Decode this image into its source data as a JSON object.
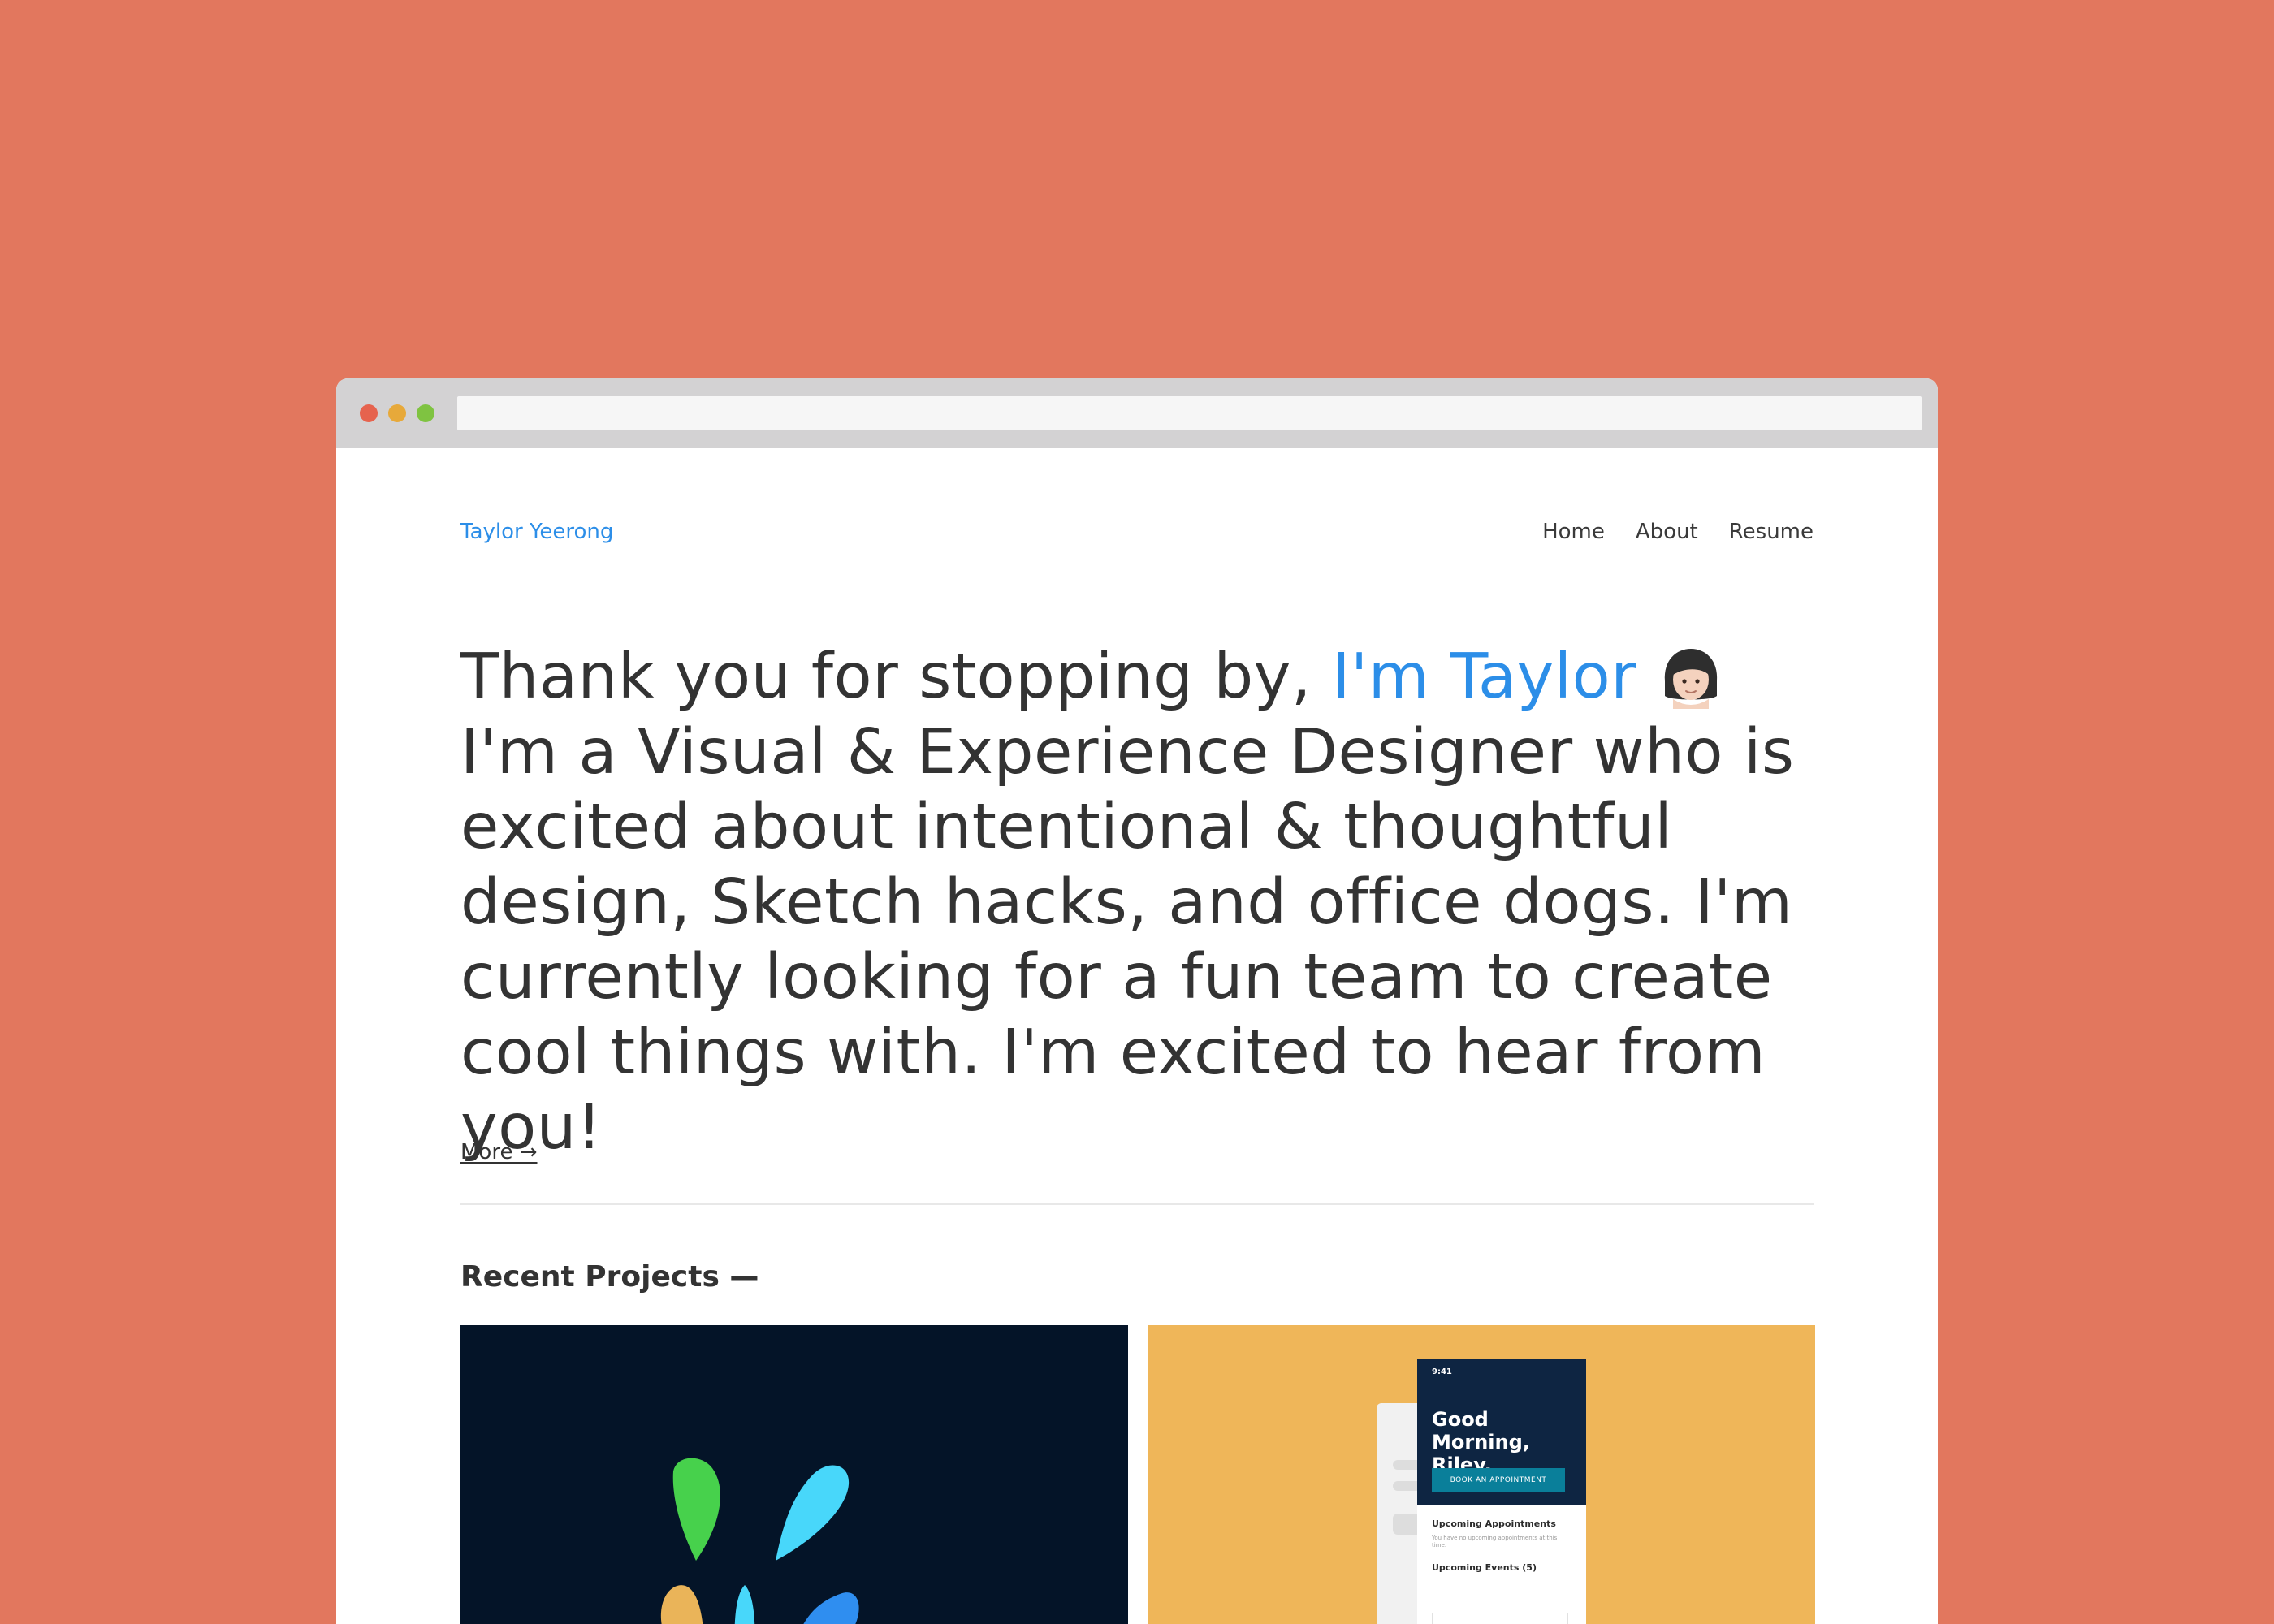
{
  "header": {
    "brand": "Taylor Yeerong",
    "nav": [
      "Home",
      "About",
      "Resume"
    ]
  },
  "intro": {
    "lead": "Thank you for stopping by, ",
    "name": "I'm Taylor",
    "avatar_icon": "woman-emoji-icon",
    "rest": " I'm a Visual & Experience Designer who is excited about intentional & thoughtful design, Sketch hacks, and office dogs. I'm currently looking for a fun team to create cool things with. I'm excited to hear from you!",
    "more": "More →"
  },
  "recent_projects": {
    "heading": "Recent Projects —",
    "projects": [
      {
        "name": "splash-logo-project",
        "background": "#041428"
      },
      {
        "name": "booking-app-project",
        "background": "#EFB659",
        "phone": {
          "time": "9:41",
          "greeting": "Good Morning, Riley.",
          "button": "BOOK AN APPOINTMENT",
          "section1": "Upcoming Appointments",
          "section1_sub": "You have no upcoming appointments at this time.",
          "section2": "Upcoming Events (5)"
        }
      }
    ]
  },
  "colors": {
    "background": "#E2775E",
    "accent": "#2C8EE8",
    "text": "#333333"
  }
}
